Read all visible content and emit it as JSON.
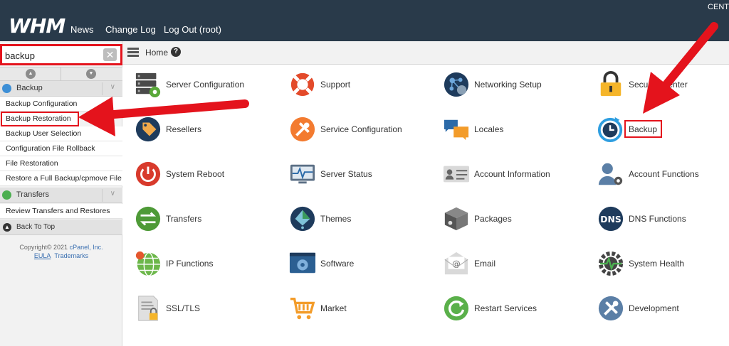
{
  "header": {
    "logo": "WHM",
    "nav": [
      "News",
      "Change Log",
      "Log Out (root)"
    ],
    "server": "CENT"
  },
  "sidebar": {
    "search": {
      "value": "backup",
      "placeholder": ""
    },
    "categories": [
      {
        "label": "Backup",
        "color": "#3d8fd6",
        "items": [
          "Backup Configuration",
          "Backup Restoration",
          "Backup User Selection",
          "Configuration File Rollback",
          "File Restoration",
          "Restore a Full Backup/cpmove File"
        ]
      },
      {
        "label": "Transfers",
        "color": "#4caf50",
        "items": [
          "Review Transfers and Restores"
        ]
      }
    ],
    "back_to_top": "Back To Top",
    "footer": {
      "copyright": "Copyright© 2021 ",
      "company": "cPanel, Inc.",
      "eula": "EULA",
      "trademarks": "Trademarks"
    }
  },
  "breadcrumb": {
    "home": "Home"
  },
  "grid": [
    [
      "Server Configuration",
      "Support",
      "Networking Setup",
      "Security Center"
    ],
    [
      "Resellers",
      "Service Configuration",
      "Locales",
      "Backup"
    ],
    [
      "System Reboot",
      "Server Status",
      "Account Information",
      "Account Functions"
    ],
    [
      "Transfers",
      "Themes",
      "Packages",
      "DNS Functions"
    ],
    [
      "IP Functions",
      "Software",
      "Email",
      "System Health"
    ],
    [
      "SSL/TLS",
      "Market",
      "Restart Services",
      "Development"
    ]
  ],
  "icons": {
    "server-configuration": "server-icon",
    "support": "lifebuoy-icon",
    "networking-setup": "network-icon",
    "security-center": "lock-icon",
    "resellers": "tag-icon",
    "service-configuration": "wrench-icon",
    "locales": "speech-bubbles-icon",
    "backup": "clock-icon",
    "system-reboot": "power-icon",
    "server-status": "monitor-icon",
    "account-information": "id-card-icon",
    "account-functions": "user-gear-icon",
    "transfers": "transfer-arrows-icon",
    "themes": "palette-icon",
    "packages": "box-icon",
    "dns-functions": "dns-icon",
    "ip-functions": "globe-icon",
    "software": "window-gear-icon",
    "email": "envelope-icon",
    "system-health": "gear-pulse-icon",
    "ssl-tls": "certificate-icon",
    "market": "cart-icon",
    "restart-services": "restart-icon",
    "development": "tools-icon"
  },
  "colors": {
    "topbar": "#293a4a",
    "highlight": "#e4131c"
  }
}
